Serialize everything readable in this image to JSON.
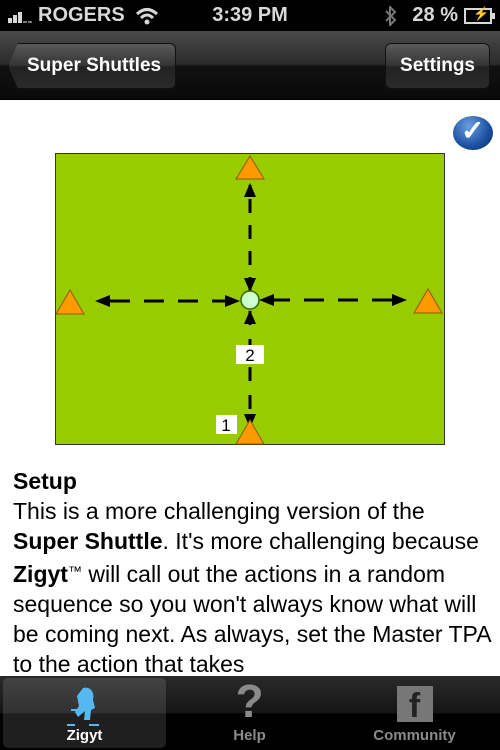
{
  "status_bar": {
    "carrier": "ROGERS",
    "time": "3:39 PM",
    "battery": "28 %",
    "icons": [
      "signal-icon",
      "wifi-icon",
      "bluetooth-icon",
      "battery-charging-icon"
    ]
  },
  "nav_bar": {
    "back_label": "Super Shuttles",
    "settings_label": "Settings"
  },
  "completion": {
    "icon": "checkmark-icon",
    "checked": true
  },
  "diagram": {
    "field_color": "#99cc00",
    "cone_color": "#ff9900",
    "center_color": "#ccffcc",
    "labels": {
      "start": "1",
      "step": "2"
    },
    "cones": [
      "top",
      "left",
      "right",
      "bottom"
    ]
  },
  "content": {
    "heading": "Setup",
    "p1": "This is a more challenging version of the ",
    "b1": "Super Shuttle",
    "p2": ". It's more challenging because ",
    "b2": "Zigyt",
    "tm": "™",
    "p3": " will call out the actions in a random sequence so you won't always know what will be coming next. As always, set the Master TPA to the action that takes"
  },
  "tab_bar": {
    "tabs": [
      {
        "label": "Zigyt",
        "icon": "runner-icon",
        "active": true
      },
      {
        "label": "Help",
        "icon": "question-mark-icon",
        "active": false
      },
      {
        "label": "Community",
        "icon": "facebook-icon",
        "active": false
      }
    ]
  }
}
